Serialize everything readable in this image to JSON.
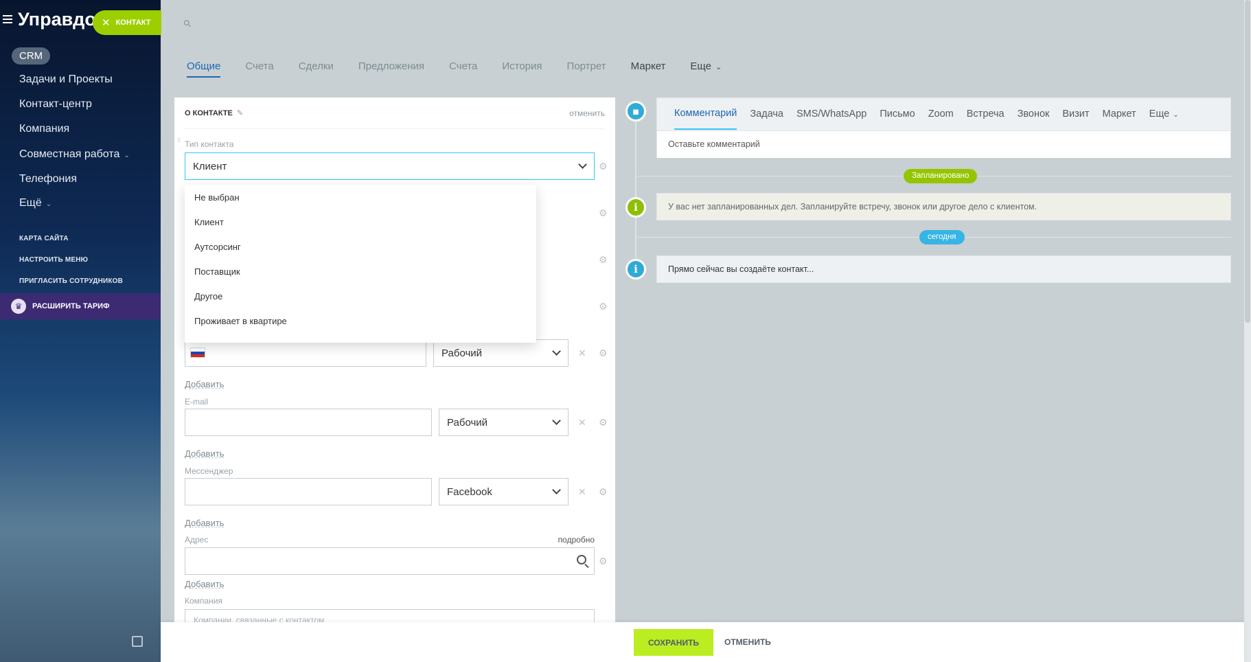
{
  "sidebar": {
    "app_title": "Управдом",
    "crm_badge": "CRM",
    "items": [
      {
        "label": "Задачи и Проекты"
      },
      {
        "label": "Контакт-центр"
      },
      {
        "label": "Компания"
      },
      {
        "label": "Совместная работа"
      },
      {
        "label": "Телефония"
      },
      {
        "label": "Ещё"
      }
    ],
    "links": [
      "КАРТА САЙТА",
      "НАСТРОИТЬ МЕНЮ",
      "ПРИГЛАСИТЬ СОТРУДНИКОВ"
    ],
    "upgrade_label": "РАСШИРИТЬ ТАРИФ"
  },
  "contact_pill": "КОНТАКТ",
  "tabs": [
    {
      "label": "Общие"
    },
    {
      "label": "Счета"
    },
    {
      "label": "Сделки"
    },
    {
      "label": "Предложения"
    },
    {
      "label": "Счета"
    },
    {
      "label": "История"
    },
    {
      "label": "Портрет"
    },
    {
      "label": "Маркет"
    },
    {
      "label": "Еще"
    }
  ],
  "card": {
    "title": "О КОНТАКТЕ",
    "cancel": "отменить",
    "contact_type_label": "Тип контакта",
    "contact_type_value": "Клиент",
    "dropdown_options": [
      "Не выбран",
      "Клиент",
      "Аутсорсинг",
      "Поставщик",
      "Другое",
      "Проживает в квартире"
    ],
    "phone_type": "Рабочий",
    "add": "Добавить",
    "email_label": "E-mail",
    "email_type": "Рабочий",
    "messenger_label": "Мессенджер",
    "messenger_type": "Facebook",
    "address_label": "Адрес",
    "address_more": "подробно",
    "company_label": "Компания",
    "company_placeholder": "Компании, связанные с контактом"
  },
  "timeline": {
    "sub_tabs": [
      "Комментарий",
      "Задача",
      "SMS/WhatsApp",
      "Письмо",
      "Zoom",
      "Встреча",
      "Звонок",
      "Визит",
      "Маркет",
      "Еще"
    ],
    "comment_placeholder": "Оставьте комментарий",
    "planned_badge": "Запланировано",
    "planned_text": "У вас нет запланированных дел. Запланируйте встречу, звонок или другое дело с клиентом.",
    "today_badge": "сегодня",
    "creating_text": "Прямо сейчас вы создаёте контакт..."
  },
  "footer": {
    "save": "СОХРАНИТЬ",
    "cancel": "ОТМЕНИТЬ"
  },
  "colors": {
    "accent_blue": "#2067b0",
    "green": "#9dcf00",
    "light_blue": "#2fc6f6"
  }
}
